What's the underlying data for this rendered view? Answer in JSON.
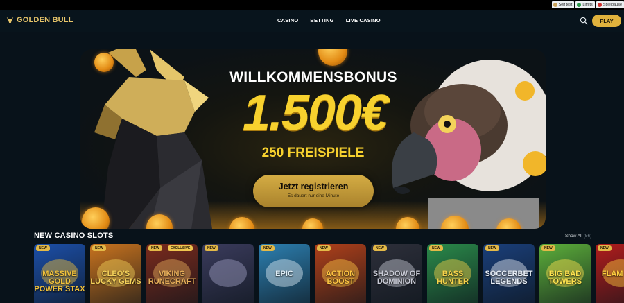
{
  "responsible_gaming": [
    {
      "label": "Self test",
      "color": "#c9a15a"
    },
    {
      "label": "Limits",
      "color": "#2e9a4a"
    },
    {
      "label": "Spielpause",
      "color": "#d0312d"
    }
  ],
  "header": {
    "logo_text": "GOLDEN BULL",
    "nav": [
      "CASINO",
      "BETTING",
      "LIVE CASINO"
    ],
    "search_icon": "search-icon",
    "play_label": "PLAY"
  },
  "hero": {
    "title": "WILLKOMMENSBONUS",
    "amount": "1.500€",
    "freespins": "250 FREISPIELE",
    "cta": {
      "label": "Jetzt registrieren",
      "sub": "Es dauert nur eine Minute"
    }
  },
  "slots": {
    "title": "NEW CASINO SLOTS",
    "show_all": "Show All",
    "count": "(56)",
    "tiles": [
      {
        "badge": "NEW",
        "name": "MASSIVE GOLD POWER STAX",
        "bg": "#1c4fa8",
        "accent": "#f2c23b"
      },
      {
        "badge": "NEW",
        "name": "CLEO'S LUCKY GEMS",
        "bg": "#c8731e",
        "accent": "#f5d25a"
      },
      {
        "badge": "NEW",
        "badge2": "EXCLUSIVE",
        "name": "VIKING RUNECRAFT",
        "bg": "#7a2a1c",
        "accent": "#e9b05a"
      },
      {
        "badge": "NEW",
        "name": "",
        "bg": "#3a3b5c",
        "accent": "#9fa0c4"
      },
      {
        "badge": "NEW",
        "name": "EPIC",
        "bg": "#2c7fb0",
        "accent": "#dfeef7"
      },
      {
        "badge": "NEW",
        "name": "ACTION BOOST",
        "bg": "#b0401a",
        "accent": "#ffc642"
      },
      {
        "badge": "NEW",
        "name": "SHADOW OF DOMINION",
        "bg": "#2d2f3a",
        "accent": "#c9cbd6"
      },
      {
        "badge": "NEW",
        "name": "BASS HUNTER",
        "bg": "#2a8a4a",
        "accent": "#f6d34a"
      },
      {
        "badge": "NEW",
        "name": "SOCCERBET LEGENDS",
        "bg": "#1a3f7a",
        "accent": "#e8eef7"
      },
      {
        "badge": "NEW",
        "name": "BIG BAD TOWERS",
        "bg": "#5cae3a",
        "accent": "#ffe34f"
      },
      {
        "badge": "NEW",
        "name": "FLAM DEV",
        "bg": "#b01c1c",
        "accent": "#ffcf3f"
      }
    ]
  }
}
